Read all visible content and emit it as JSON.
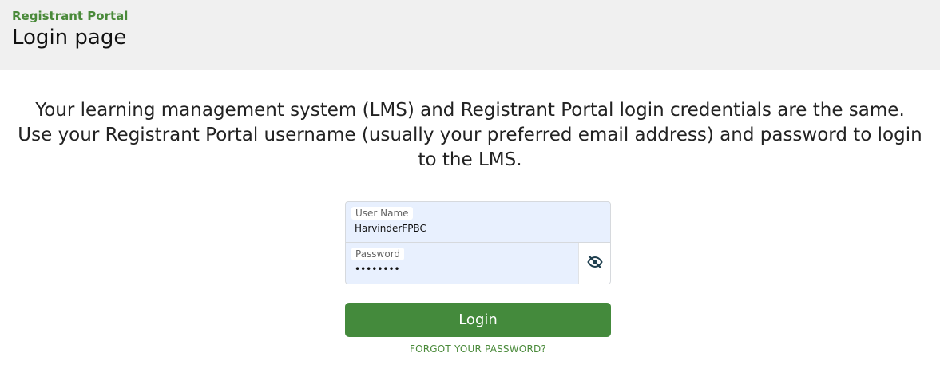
{
  "header": {
    "portal_name": "Registrant Portal",
    "page_title": "Login page"
  },
  "intro": {
    "text": "Your learning management system (LMS) and Registrant Portal login credentials are the same. Use your Registrant Portal username (usually your preferred email address) and password to login to the LMS."
  },
  "form": {
    "username": {
      "label": "User Name",
      "value": "HarvinderFPBC"
    },
    "password": {
      "label": "Password",
      "value": "••••••••",
      "toggle_icon": "eye-slash-icon"
    }
  },
  "actions": {
    "login_label": "Login",
    "forgot_label": "FORGOT YOUR PASSWORD?"
  },
  "colors": {
    "brand_green": "#448a3c",
    "field_background": "#e8f0fe",
    "header_background": "#f0f0f0"
  }
}
